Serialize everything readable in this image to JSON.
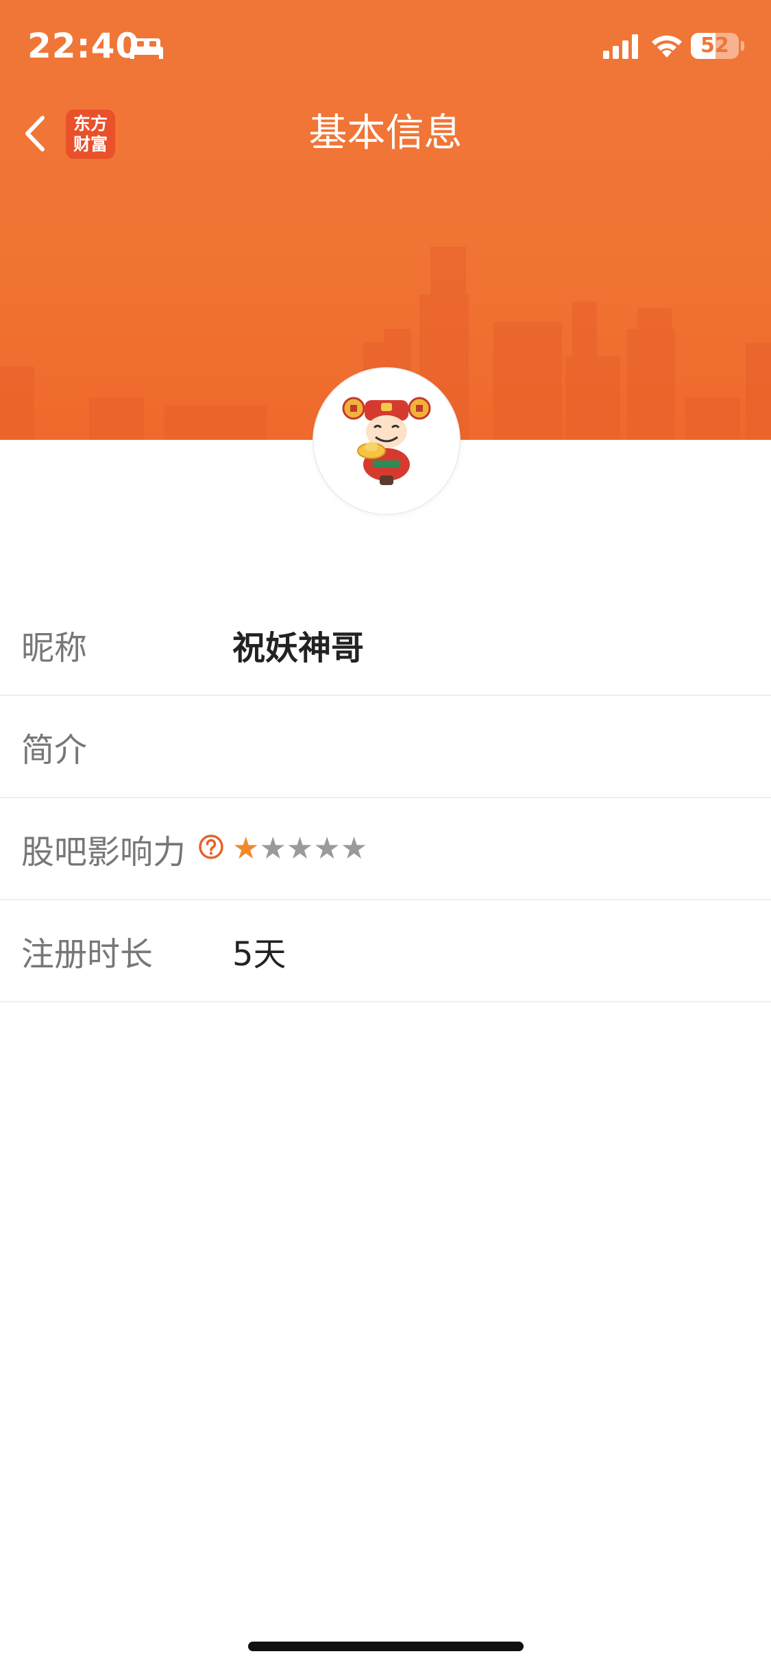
{
  "status_bar": {
    "time": "22:40",
    "battery_level": "52",
    "battery_fraction": 0.52,
    "icons": [
      "sleep-bed-icon",
      "cellular-signal-icon",
      "wifi-icon",
      "battery-icon"
    ]
  },
  "nav": {
    "title": "基本信息",
    "back_icon": "chevron-left-icon",
    "logo_line1": "东方",
    "logo_line2": "财富"
  },
  "profile": {
    "avatar_icon": "god-of-wealth-avatar-icon",
    "rows": [
      {
        "label": "昵称",
        "value": "祝妖神哥"
      },
      {
        "label": "简介",
        "value": ""
      },
      {
        "label": "股吧影响力",
        "help_icon": "question-circle-icon",
        "stars_total": 5,
        "stars_filled": 1
      },
      {
        "label": "注册时长",
        "value": "5天"
      }
    ]
  },
  "colors": {
    "header_orange": "#f07638",
    "star_active": "#f08a2c",
    "star_inactive": "#9a9a9a",
    "label_gray": "#777777",
    "value_dark": "#222222"
  }
}
